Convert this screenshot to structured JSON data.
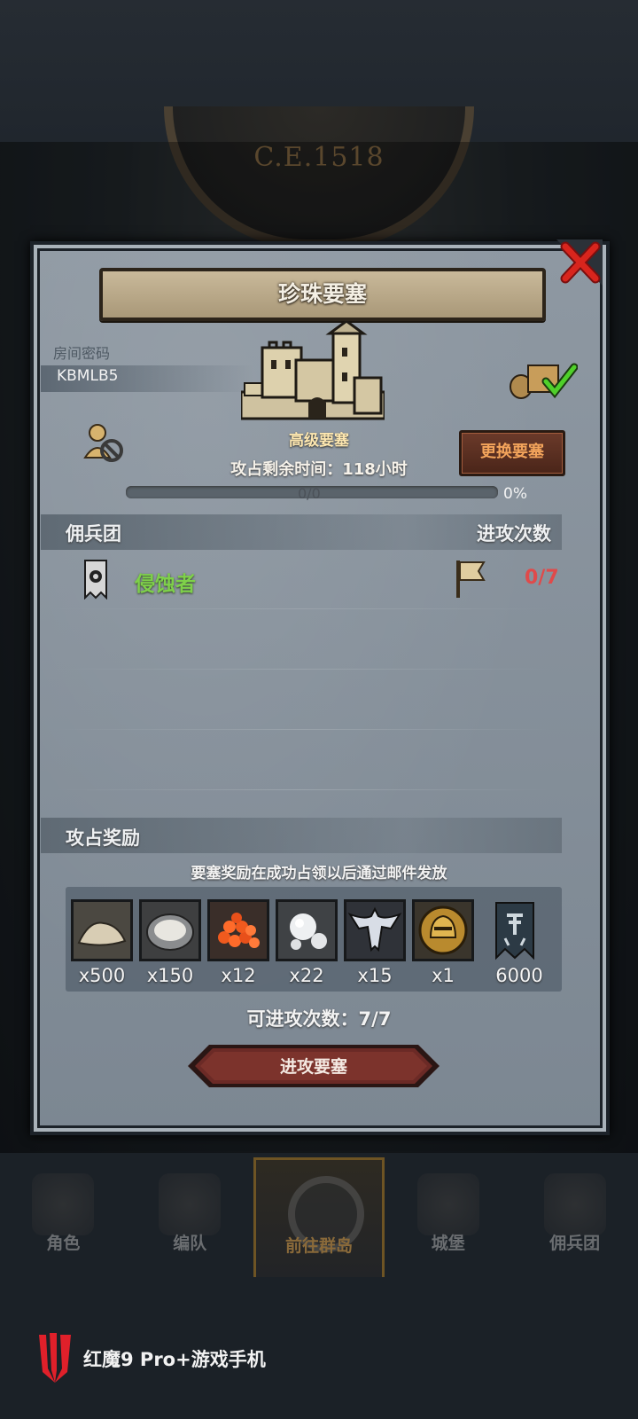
{
  "background": {
    "dial_year": "C.E.1518"
  },
  "dialog": {
    "title": "珍珠要塞",
    "room_label": "房间密码",
    "room_code": "KBMLB5",
    "fortress_type": "高级要塞",
    "change_button": "更换要塞",
    "time_remaining": "攻占剩余时间：118小时",
    "progress_text": "0/0",
    "progress_percent": "0%",
    "progress_value": 0,
    "section_mercenary": "佣兵团",
    "section_attacks": "进攻次数",
    "mercenary": {
      "name": "侵蚀者",
      "attack_count": "0/7"
    },
    "section_rewards": "攻占奖励",
    "reward_note": "要塞奖励在成功占领以后通过邮件发放",
    "rewards": [
      {
        "icon": "sand-icon",
        "qty": "x500"
      },
      {
        "icon": "oyster-icon",
        "qty": "x150"
      },
      {
        "icon": "roe-icon",
        "qty": "x12"
      },
      {
        "icon": "pearl-icon",
        "qty": "x22"
      },
      {
        "icon": "wing-emblem-icon",
        "qty": "x15"
      },
      {
        "icon": "helmet-coin-icon",
        "qty": "x1"
      },
      {
        "icon": "banner-icon",
        "qty": "6000"
      }
    ],
    "attack_count_text": "可进攻次数：7/7",
    "attack_button": "进攻要塞"
  },
  "nav": {
    "items": [
      {
        "label": "角色"
      },
      {
        "label": "编队"
      },
      {
        "label": "前往群岛"
      },
      {
        "label": "城堡"
      },
      {
        "label": "佣兵团"
      }
    ],
    "active_index": 2
  },
  "brand": {
    "text": "红魔9 Pro+游戏手机"
  },
  "colors": {
    "merc_green": "#7ed04a",
    "count_red": "#e04a4a",
    "change_btn_text": "#f3a45b",
    "attack_btn": "#6b2a26"
  }
}
